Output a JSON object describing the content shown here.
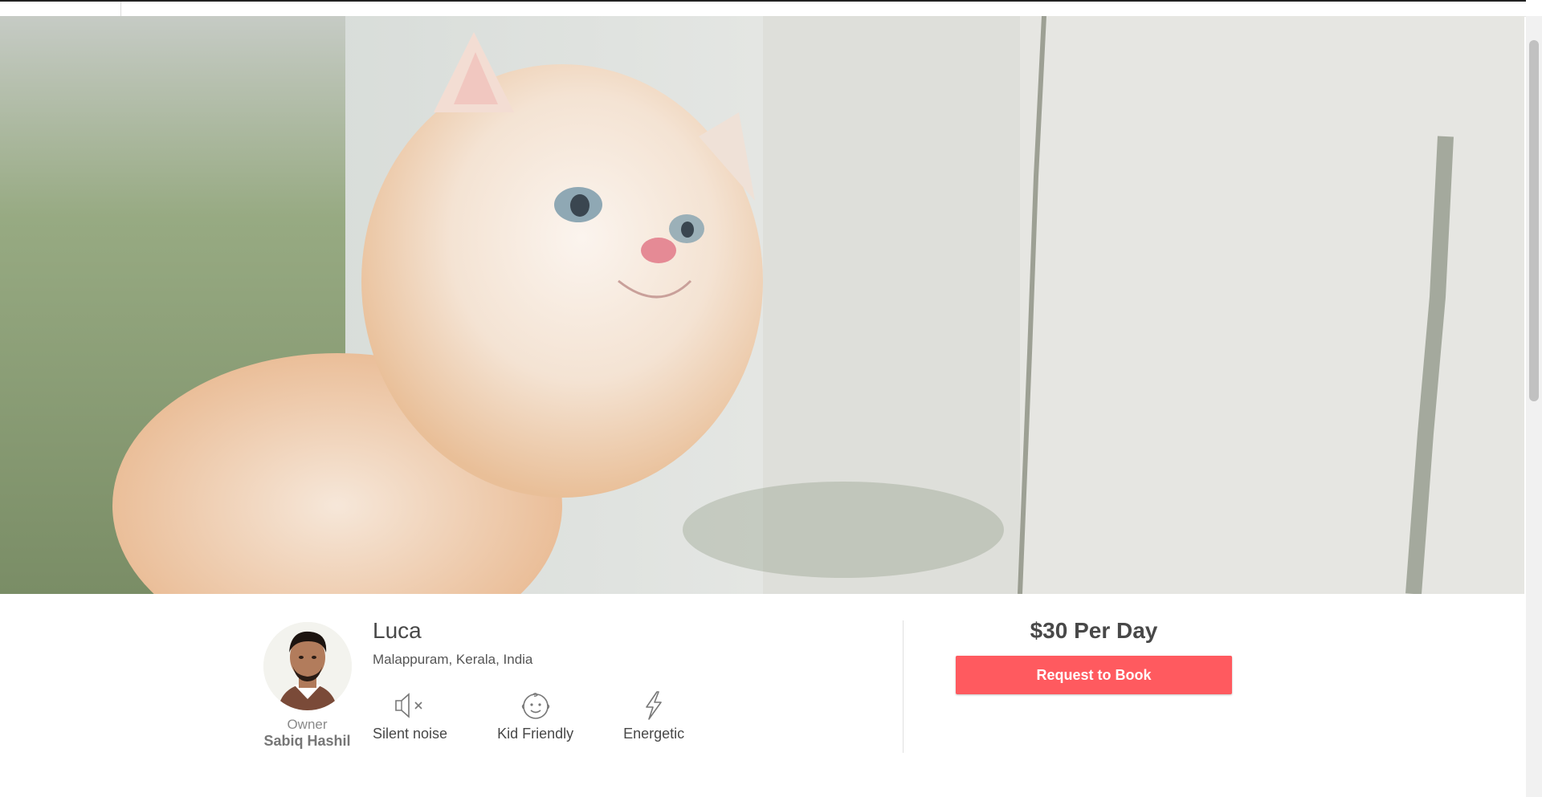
{
  "pet": {
    "name": "Luca",
    "location": "Malappuram, Kerala, India"
  },
  "owner": {
    "label": "Owner",
    "name": "Sabiq Hashil"
  },
  "traits": [
    {
      "label": "Silent noise",
      "icon": "speaker-muted-icon"
    },
    {
      "label": "Kid Friendly",
      "icon": "baby-face-icon"
    },
    {
      "label": "Energetic",
      "icon": "lightning-bolt-icon"
    }
  ],
  "booking": {
    "price": "$30 Per Day",
    "button_label": "Request to Book"
  },
  "colors": {
    "accent": "#ff5a5f",
    "text": "#484848",
    "muted": "#8a8a8a"
  }
}
